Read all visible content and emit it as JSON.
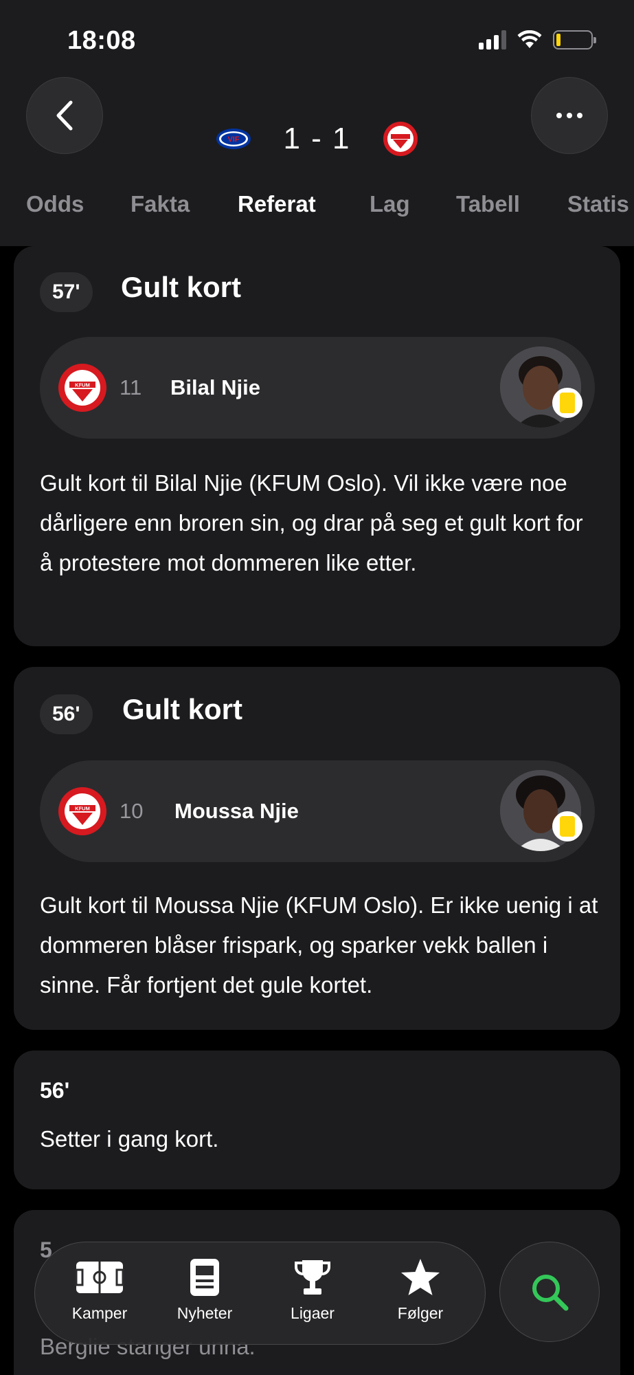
{
  "status_bar": {
    "time": "18:08"
  },
  "header": {
    "home_team": {
      "name": "Vålerenga",
      "badge_text": "VIF",
      "color": "#0033a0"
    },
    "score": "1 - 1",
    "away_team": {
      "name": "KFUM Oslo",
      "color": "#d71920"
    }
  },
  "tabs": [
    {
      "label": "Odds"
    },
    {
      "label": "Fakta"
    },
    {
      "label": "Referat",
      "active": true
    },
    {
      "label": "Lag"
    },
    {
      "label": "Tabell"
    },
    {
      "label": "Statis"
    }
  ],
  "events": [
    {
      "minute": "57'",
      "title": "Gult kort",
      "player_number": "11",
      "player_name": "Bilal Njie",
      "text": "Gult kort til Bilal Njie (KFUM Oslo). Vil ikke være noe dårligere enn broren sin, og drar på seg et gult kort for å protestere mot dommeren like etter."
    },
    {
      "minute": "56'",
      "title": "Gult kort",
      "player_number": "10",
      "player_name": "Moussa Njie",
      "text": "Gult kort til Moussa Njie (KFUM Oslo). Er ikke uenig i at dommeren blåser frispark, og sparker vekk ballen i sinne. Får fortjent det gule kortet."
    },
    {
      "minute": "56'",
      "text": "Setter i gang kort."
    },
    {
      "minute": "5",
      "text_partial": "Berglie stanger unna."
    }
  ],
  "bottom_nav": {
    "items": [
      {
        "label": "Kamper",
        "icon": "pitch-icon"
      },
      {
        "label": "Nyheter",
        "icon": "news-icon"
      },
      {
        "label": "Ligaer",
        "icon": "trophy-icon"
      },
      {
        "label": "Følger",
        "icon": "star-icon"
      }
    ],
    "search_icon": "search-icon",
    "search_color": "#34c759"
  },
  "colors": {
    "background": "#000000",
    "card": "#1c1c1e",
    "card_inner": "#2c2c2e",
    "muted_text": "#8e8e93",
    "yellow_card": "#ffd60a",
    "kfum_red": "#d71920"
  }
}
